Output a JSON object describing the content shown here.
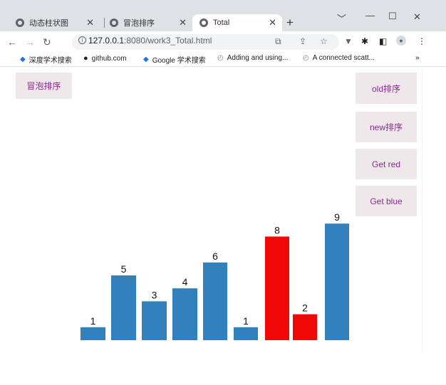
{
  "browser": {
    "tabs": [
      {
        "title": "动态柱状图",
        "active": false
      },
      {
        "title": "冒泡排序",
        "active": false
      },
      {
        "title": "Total",
        "active": true
      }
    ],
    "address": {
      "host": "127.0.0.1",
      "path": ":8080/work3_Total.html"
    },
    "bookmarks": [
      {
        "label": "深度学术搜索",
        "icon": "diamond-icon"
      },
      {
        "label": "github.com",
        "icon": "github-icon"
      },
      {
        "label": "Google 学术搜索",
        "icon": "diamond-icon"
      },
      {
        "label": "Adding and using...",
        "icon": "chart-icon"
      },
      {
        "label": "A connected scatt...",
        "icon": "chart-icon"
      }
    ],
    "more_bookmarks": "»"
  },
  "page": {
    "bubble_sort_label": "冒泡排序",
    "old_sort_label": "old排序",
    "new_sort_label": "new排序",
    "get_red_label": "Get red",
    "get_blue_label": "Get blue"
  },
  "colors": {
    "blue": "#3280bc",
    "red": "#f20707",
    "button_bg": "#eee8ea",
    "button_text": "#8a2a8f"
  },
  "chart_data": {
    "type": "bar",
    "values": [
      1,
      5,
      3,
      4,
      6,
      1,
      8,
      2,
      9
    ],
    "bar_colors": [
      "blue",
      "blue",
      "blue",
      "blue",
      "blue",
      "blue",
      "red",
      "red",
      "blue"
    ],
    "title": "",
    "xlabel": "",
    "ylabel": "",
    "ylim": [
      0,
      9
    ],
    "grid": false
  }
}
